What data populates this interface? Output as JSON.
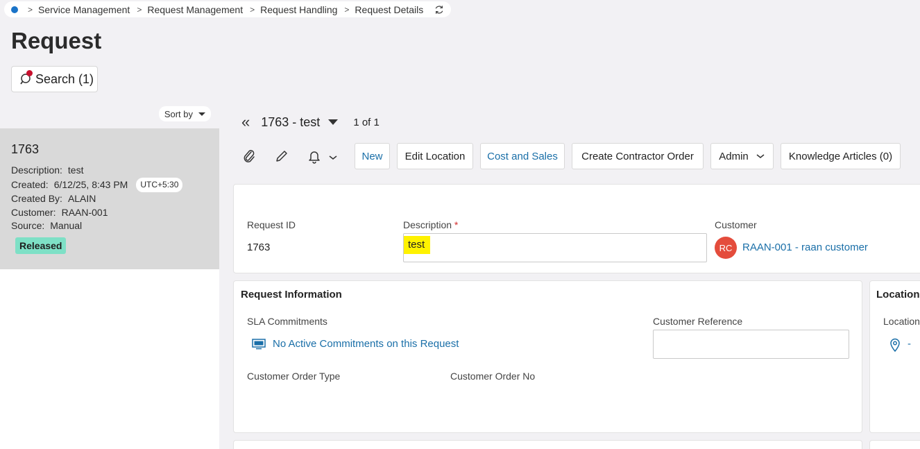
{
  "breadcrumb": {
    "items": [
      "Service Management",
      "Request Management",
      "Request Handling",
      "Request Details"
    ]
  },
  "page": {
    "title": "Request"
  },
  "search": {
    "label": "Search (1)"
  },
  "list": {
    "sort_label": "Sort by",
    "card": {
      "id": "1763",
      "description_label": "Description:",
      "description_value": "test",
      "created_label": "Created:",
      "created_value": "6/12/25, 8:43 PM",
      "timezone": "UTC+5:30",
      "created_by_label": "Created By:",
      "created_by_value": "ALAIN",
      "customer_label": "Customer:",
      "customer_value": "RAAN-001",
      "source_label": "Source:",
      "source_value": "Manual",
      "status": "Released"
    }
  },
  "record": {
    "title": "1763 - test",
    "count": "1 of 1"
  },
  "toolbar": {
    "new": "New",
    "edit_location": "Edit Location",
    "cost_and_sales": "Cost and Sales",
    "create_contractor_order": "Create Contractor Order",
    "admin": "Admin",
    "knowledge_articles": "Knowledge Articles (0)"
  },
  "header": {
    "request_id_label": "Request ID",
    "request_id_value": "1763",
    "description_label": "Description",
    "description_required": "*",
    "description_value": "test",
    "customer_label": "Customer",
    "customer_avatar": "RC",
    "customer_value": "RAAN-001 - raan customer"
  },
  "request_info": {
    "title": "Request Information",
    "sla_label": "SLA Commitments",
    "sla_value": "No Active Commitments on this Request",
    "customer_reference_label": "Customer Reference",
    "customer_reference_value": "",
    "customer_order_type_label": "Customer Order Type",
    "customer_order_no_label": "Customer Order No"
  },
  "location": {
    "title": "Location",
    "field_label": "Location",
    "field_value": "-"
  },
  "colors": {
    "accent": "#1a6fa8",
    "status_released": "#7ee0c6",
    "avatar": "#e44c3c",
    "highlight": "#fff200",
    "required": "#d32f2f"
  }
}
